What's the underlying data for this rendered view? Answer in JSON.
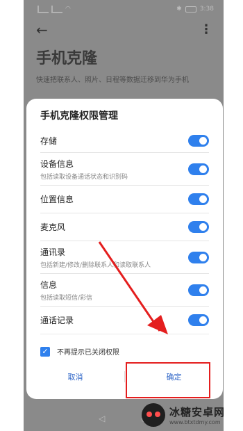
{
  "status_bar": {
    "time": "3:38"
  },
  "app_bar": {
    "back_icon": "back-arrow-icon",
    "more_icon": "more-vertical-icon"
  },
  "page": {
    "title": "手机克隆",
    "subtitle": "快速把联系人、照片、日程等数据迁移到华为手机"
  },
  "dialog": {
    "title": "手机克隆权限管理",
    "permissions": [
      {
        "label": "存储",
        "desc": "",
        "enabled": true
      },
      {
        "label": "设备信息",
        "desc": "包括读取设备通话状态和识别码",
        "enabled": true
      },
      {
        "label": "位置信息",
        "desc": "",
        "enabled": true
      },
      {
        "label": "麦克风",
        "desc": "",
        "enabled": true
      },
      {
        "label": "通讯录",
        "desc": "包括新建/修改/删除联系人和读取联系人",
        "enabled": true
      },
      {
        "label": "信息",
        "desc": "包括读取短信/彩信",
        "enabled": true
      },
      {
        "label": "通话记录",
        "desc": "",
        "enabled": true
      }
    ],
    "checkbox": {
      "label": "不再提示已关闭权限",
      "checked": true
    },
    "cancel_label": "取消",
    "confirm_label": "确定"
  },
  "watermark": {
    "name": "冰糖安卓网",
    "url": "www.btxtdmy.com"
  },
  "colors": {
    "accent": "#2f80ed",
    "annotation": "#e41e1e"
  }
}
